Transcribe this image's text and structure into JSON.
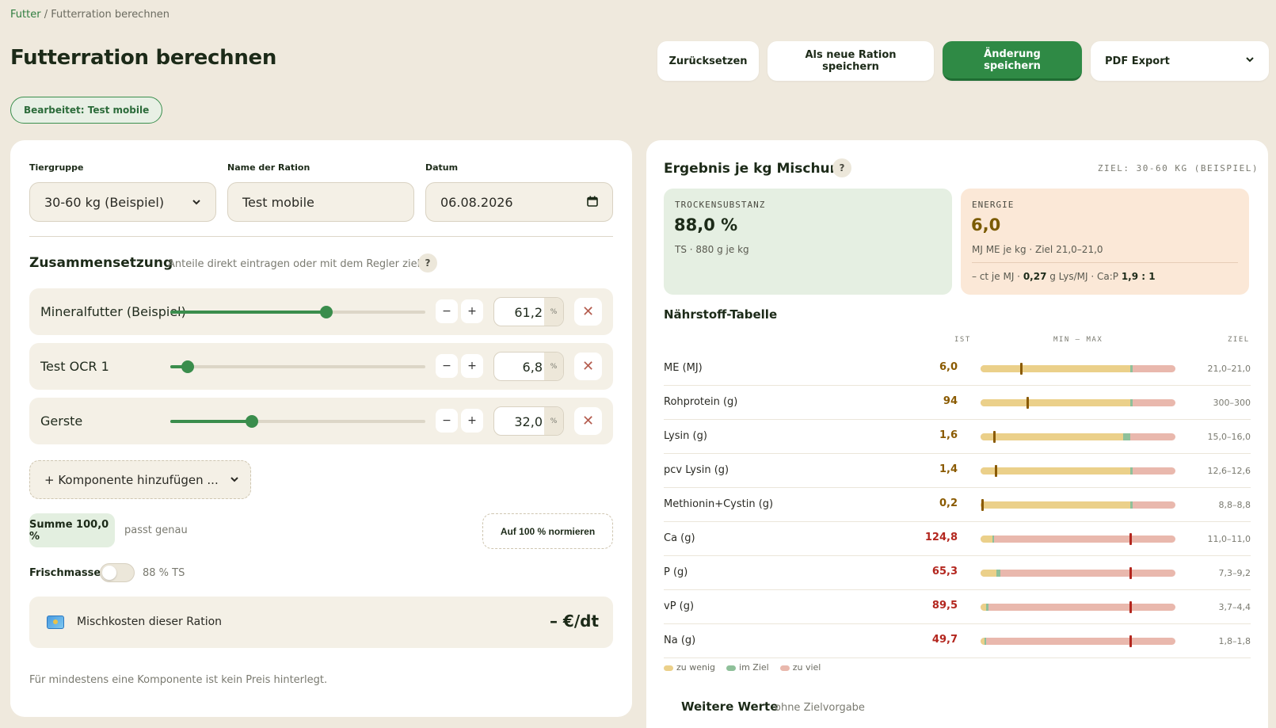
{
  "breadcrumb": {
    "parent": "Futter",
    "separator": "/",
    "current": "Futterration berechnen"
  },
  "page_title": "Futterration berechnen",
  "toolbar": {
    "reset": "Zurücksetzen",
    "save_new": "Als neue Ration speichern",
    "save_changes": "Änderung speichern",
    "pdf_export": "PDF Export"
  },
  "edit_badge": "Bearbeitet: Test mobile",
  "form": {
    "tiergruppe_label": "Tiergruppe",
    "tiergruppe_value": "30-60 kg (Beispiel)",
    "name_label": "Name der Ration",
    "name_value": "Test mobile",
    "datum_label": "Datum",
    "datum_value": "06.08.2026"
  },
  "composition": {
    "title": "Zusammensetzung",
    "subtitle": "Anteile direkt eintragen oder mit dem Regler ziehen",
    "help": "?",
    "minus": "−",
    "plus": "+",
    "remove": "✕",
    "unit": "%",
    "items": [
      {
        "name": "Mineralfutter (Beispiel)",
        "value": "61,2",
        "fraction": 0.612
      },
      {
        "name": "Test OCR 1",
        "value": "6,8",
        "fraction": 0.068
      },
      {
        "name": "Gerste",
        "value": "32,0",
        "fraction": 0.32
      }
    ],
    "add_component": "+ Komponente hinzufügen ...",
    "sum": "Summe 100,0 %",
    "sum_note": "passt genau",
    "normalize": "Auf 100 % normieren",
    "fresh_label": "Frischmasse",
    "fresh_note": "88 % TS",
    "cost_label": "Mischkosten dieser Ration",
    "cost_value": "– €/dt",
    "footnote": "Für mindestens eine Komponente ist kein Preis hinterlegt."
  },
  "result": {
    "title": "Ergebnis je kg Mischung",
    "help": "?",
    "target": "ZIEL: 30-60 KG (BEISPIEL)",
    "ts": {
      "caption": "TROCKENSUBSTANZ",
      "value": "88,0 %",
      "sub": "TS · 880 g je kg"
    },
    "energy": {
      "caption": "ENERGIE",
      "value": "6,0",
      "sub": "MJ ME je kg · Ziel 21,0–21,0",
      "extra_prefix": "– ct je MJ · ",
      "lys": "0,27",
      "extra_mid": " g Lys/MJ · Ca:P ",
      "ratio": "1,9 : 1"
    }
  },
  "nutrients": {
    "title": "Nährstoff-Tabelle",
    "head_ist": "IST",
    "head_range": "MIN — MAX",
    "head_ziel": "ZIEL",
    "colors": {
      "low": "#ebd08a",
      "in_target": "#8fc09a",
      "high": "#e9b8ad",
      "low_text": "#8a5a00",
      "high_text": "#b3261e"
    },
    "rows": [
      {
        "name": "ME (MJ)",
        "ist": "6,0",
        "ziel": "21,0–21,0",
        "status": "low",
        "marker": 0.21,
        "target_lo": 0.77,
        "target_hi": 0.77
      },
      {
        "name": "Rohprotein (g)",
        "ist": "94",
        "ziel": "300–300",
        "status": "low",
        "marker": 0.24,
        "target_lo": 0.77,
        "target_hi": 0.77
      },
      {
        "name": "Lysin (g)",
        "ist": "1,6",
        "ziel": "15,0–16,0",
        "status": "low",
        "marker": 0.07,
        "target_lo": 0.73,
        "target_hi": 0.77
      },
      {
        "name": "pcv Lysin (g)",
        "ist": "1,4",
        "ziel": "12,6–12,6",
        "status": "low",
        "marker": 0.08,
        "target_lo": 0.77,
        "target_hi": 0.77
      },
      {
        "name": "Methionin+Cystin (g)",
        "ist": "0,2",
        "ziel": "8,8–8,8",
        "status": "low",
        "marker": 0.01,
        "target_lo": 0.77,
        "target_hi": 0.77
      },
      {
        "name": "Ca (g)",
        "ist": "124,8",
        "ziel": "11,0–11,0",
        "status": "high",
        "marker": 0.77,
        "target_lo": 0.06,
        "target_hi": 0.06
      },
      {
        "name": "P (g)",
        "ist": "65,3",
        "ziel": "7,3–9,2",
        "status": "high",
        "marker": 0.77,
        "target_lo": 0.08,
        "target_hi": 0.1
      },
      {
        "name": "vP (g)",
        "ist": "89,5",
        "ziel": "3,7–4,4",
        "status": "high",
        "marker": 0.77,
        "target_lo": 0.03,
        "target_hi": 0.04
      },
      {
        "name": "Na (g)",
        "ist": "49,7",
        "ziel": "1,8–1,8",
        "status": "high",
        "marker": 0.77,
        "target_lo": 0.02,
        "target_hi": 0.02
      }
    ],
    "legend": {
      "low": "zu wenig",
      "in_target": "im Ziel",
      "high": "zu viel"
    }
  },
  "more_values": {
    "title": "Weitere Werte",
    "subtitle": "ohne Zielvorgabe"
  },
  "icons": {
    "calendar": "calendar-icon",
    "chevron": "chevron-down-icon",
    "cost": "banknote-icon",
    "close": "close-icon"
  }
}
